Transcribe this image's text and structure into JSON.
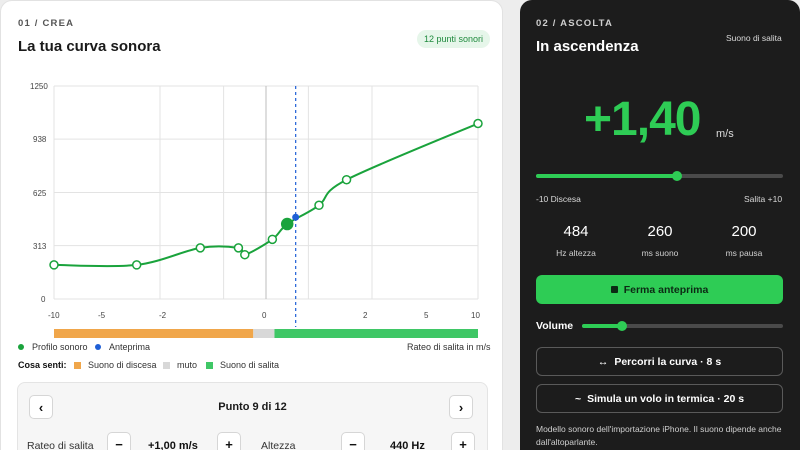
{
  "left": {
    "kicker": "01 / CREA",
    "title": "La tua curva sonora",
    "badge": "12 punti sonori",
    "y_ticks": [
      "1250",
      "938",
      "625",
      "313",
      "0"
    ],
    "x_ticks": [
      "-10",
      "-5",
      "-2",
      "0",
      "2",
      "5",
      "10"
    ],
    "legend": {
      "profile": "Profilo sonoro",
      "preview": "Anteprima",
      "axis_note": "Rateo di salita in m/s"
    },
    "hear": {
      "label": "Cosa senti:",
      "descent": "Suono di discesa",
      "mute": "muto",
      "climb": "Suono di salita"
    },
    "point_editor": {
      "prev": "‹",
      "next": "›",
      "title": "Punto 9 di 12",
      "rate_label": "Rateo di salita",
      "rate_value": "+1,00 m/s",
      "height_label": "Altezza",
      "height_value": "440 Hz",
      "minus": "−",
      "plus": "+"
    }
  },
  "chart_data": {
    "type": "line",
    "xlabel": "Rateo di salita in m/s",
    "ylabel": "",
    "xlim": [
      -10,
      10
    ],
    "ylim": [
      0,
      1250
    ],
    "x_tick_labels": [
      -10,
      -5,
      -2,
      0,
      2,
      5,
      10
    ],
    "y_tick_labels": [
      0,
      313,
      625,
      938,
      1250
    ],
    "series": [
      {
        "name": "Profilo sonoro",
        "points": [
          [
            -10,
            200
          ],
          [
            -6.1,
            200
          ],
          [
            -3.1,
            300
          ],
          [
            -1.3,
            300
          ],
          [
            -1.0,
            260
          ],
          [
            0.3,
            350
          ],
          [
            1.0,
            440
          ],
          [
            2.5,
            550
          ],
          [
            3.8,
            700
          ],
          [
            10.0,
            1030
          ]
        ]
      }
    ],
    "selected_point": [
      1.0,
      440
    ],
    "preview": {
      "name": "Anteprima",
      "x": 1.4,
      "y": 480
    },
    "bands": [
      {
        "name": "Suono di discesa",
        "from": -10,
        "to": -0.6,
        "color": "#f0a64a"
      },
      {
        "name": "muto",
        "from": -0.6,
        "to": 0.4,
        "color": "#d8d8d8"
      },
      {
        "name": "Suono di salita",
        "from": 0.4,
        "to": 10,
        "color": "#3fc766"
      }
    ],
    "colors": {
      "line": "#1aa33c",
      "preview": "#1f5fd6"
    },
    "grid": true,
    "legend_position": "bottom-left"
  },
  "right": {
    "kicker": "02 / ASCOLTA",
    "title": "In ascendenza",
    "subtitle": "Suono di salita",
    "value": "+1,40",
    "unit": "m/s",
    "slider": {
      "min_label": "-10 Discesa",
      "max_label": "Salita +10",
      "value": 1.4,
      "min": -10,
      "max": 10
    },
    "stats": [
      {
        "value": "484",
        "label": "Hz altezza"
      },
      {
        "value": "260",
        "label": "ms suono"
      },
      {
        "value": "200",
        "label": "ms pausa"
      }
    ],
    "stop_button": "Ferma anteprima",
    "volume": {
      "label": "Volume",
      "level": 0.2
    },
    "sweep_button": "Percorri la curva · 8 s",
    "thermal_button": "Simula un volo in termica · 20 s",
    "note": "Modello sonoro dell'importazione iPhone. Il suono dipende anche dall'altoparlante.",
    "accent": "#2ecc55"
  }
}
